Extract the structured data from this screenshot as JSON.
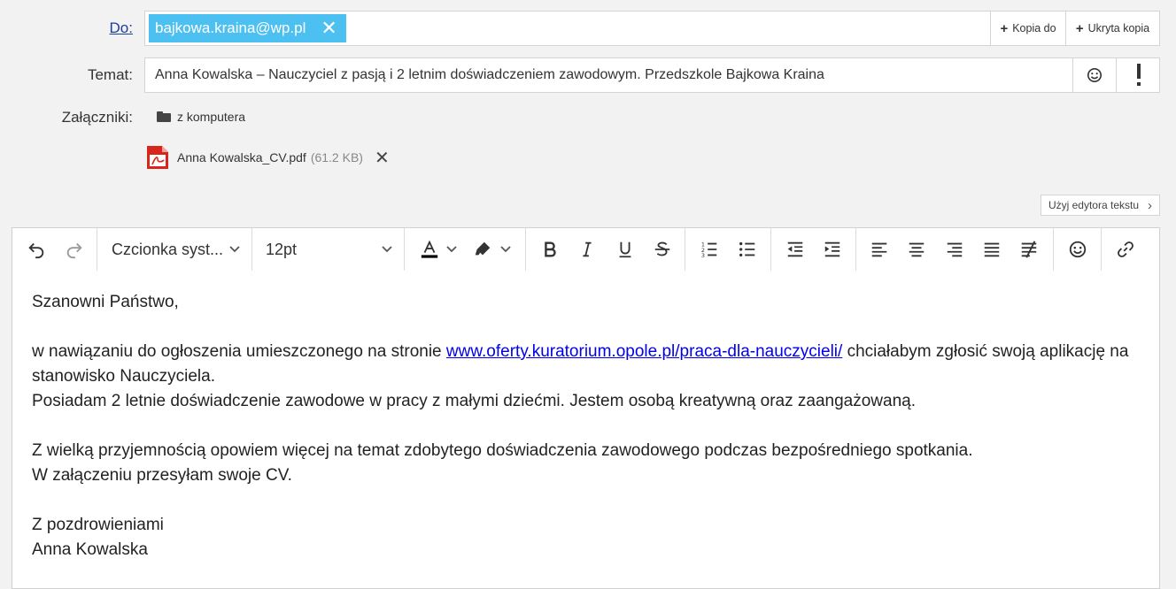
{
  "header": {
    "to_label": "Do:",
    "to_recipient": "bajkowa.kraina@wp.pl",
    "cc_button": "Kopia do",
    "bcc_button": "Ukryta kopia",
    "subject_label": "Temat:",
    "subject_value": "Anna Kowalska – Nauczyciel z pasją i 2 letnim doświadczeniem zawodowym. Przedszkole Bajkowa Kraina",
    "attachments_label": "Załączniki:",
    "attach_from_computer": "z komputera",
    "attachment": {
      "name": "Anna Kowalska_CV.pdf",
      "size": "(61.2 KB)"
    },
    "editor_switch": "Użyj edytora tekstu"
  },
  "toolbar": {
    "font_family": "Czcionka syst...",
    "font_size": "12pt",
    "icons": [
      "undo-icon",
      "redo-icon",
      "text-color-icon",
      "highlight-icon",
      "bold-icon",
      "italic-icon",
      "underline-icon",
      "strikethrough-icon",
      "numbered-list-icon",
      "bullet-list-icon",
      "outdent-icon",
      "indent-icon",
      "align-left-icon",
      "align-center-icon",
      "align-right-icon",
      "justify-icon",
      "clear-format-icon",
      "emoji-icon",
      "link-icon"
    ]
  },
  "body": {
    "greeting": "Szanowni Państwo,",
    "para1_before": "w nawiązaniu do ogłoszenia umieszczonego na stronie ",
    "para1_link": "www.oferty.kuratorium.opole.pl/praca-dla-nauczycieli/",
    "para1_after": " chciałabym zgłosić swoją aplikację na stanowisko Nauczyciela.",
    "para2": "Posiadam 2 letnie doświadczenie zawodowe w pracy z małymi dziećmi. Jestem osobą kreatywną oraz zaangażowaną.",
    "para3": "Z wielką przyjemnością opowiem więcej na temat zdobytego doświadczenia zawodowego podczas bezpośredniego spotkania.",
    "para4": "W załączeniu przesyłam swoje CV.",
    "closing": "Z pozdrowieniami",
    "signature": "Anna Kowalska"
  },
  "colors": {
    "chip": "#4dc0f2",
    "link": "#0000ee",
    "pdf": "#d9261c",
    "text_color_bar": "#000000"
  }
}
